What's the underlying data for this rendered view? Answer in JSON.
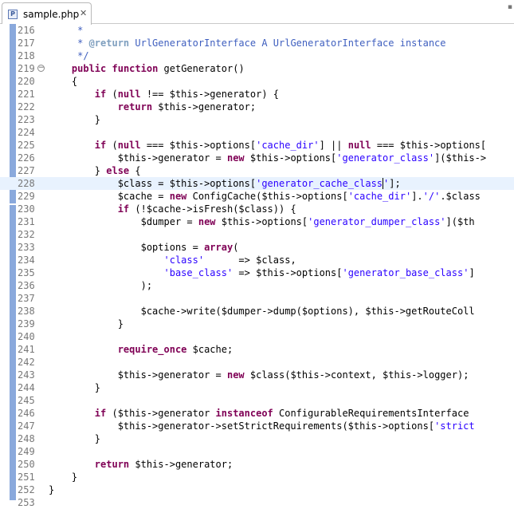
{
  "tab": {
    "filename": "sample.php",
    "icon": "php-file-icon",
    "close_glyph": "✕"
  },
  "corner_glyph": "▪",
  "cursor_line": "228",
  "code_lines": [
    {
      "n": "216",
      "t": [
        [
          "cm",
          "     * "
        ]
      ]
    },
    {
      "n": "217",
      "t": [
        [
          "cm",
          "     * "
        ],
        [
          "tag",
          "@return"
        ],
        [
          "cm",
          " UrlGeneratorInterface A UrlGeneratorInterface instance"
        ]
      ]
    },
    {
      "n": "218",
      "t": [
        [
          "cm",
          "     */"
        ]
      ]
    },
    {
      "n": "219",
      "fold": true,
      "t": [
        [
          "",
          "    "
        ],
        [
          "kw",
          "public"
        ],
        [
          "",
          " "
        ],
        [
          "kw",
          "function"
        ],
        [
          "",
          " getGenerator()"
        ]
      ]
    },
    {
      "n": "220",
      "t": [
        [
          "",
          "    {"
        ]
      ]
    },
    {
      "n": "221",
      "t": [
        [
          "",
          "        "
        ],
        [
          "kw",
          "if"
        ],
        [
          "",
          " ("
        ],
        [
          "kw",
          "null"
        ],
        [
          "",
          " !== $this->generator) {"
        ]
      ]
    },
    {
      "n": "222",
      "t": [
        [
          "",
          "            "
        ],
        [
          "kw",
          "return"
        ],
        [
          "",
          " $this->generator;"
        ]
      ]
    },
    {
      "n": "223",
      "t": [
        [
          "",
          "        }"
        ]
      ]
    },
    {
      "n": "224",
      "t": []
    },
    {
      "n": "225",
      "t": [
        [
          "",
          "        "
        ],
        [
          "kw",
          "if"
        ],
        [
          "",
          " ("
        ],
        [
          "kw",
          "null"
        ],
        [
          "",
          " === $this->options["
        ],
        [
          "str",
          "'cache_dir'"
        ],
        [
          "",
          "] || "
        ],
        [
          "kw",
          "null"
        ],
        [
          "",
          " === $this->options["
        ]
      ]
    },
    {
      "n": "226",
      "t": [
        [
          "",
          "            $this->generator = "
        ],
        [
          "kw",
          "new"
        ],
        [
          "",
          " $this->options["
        ],
        [
          "str",
          "'generator_class'"
        ],
        [
          "",
          "]($this->"
        ]
      ]
    },
    {
      "n": "227",
      "t": [
        [
          "",
          "        } "
        ],
        [
          "kw",
          "else"
        ],
        [
          "",
          " {"
        ]
      ]
    },
    {
      "n": "228",
      "t": [
        [
          "",
          "            $class = $this->options["
        ],
        [
          "str",
          "'generator_cache_class"
        ],
        [
          "caret",
          ""
        ],
        [
          "str",
          "'"
        ],
        [
          "",
          "];"
        ]
      ]
    },
    {
      "n": "229",
      "t": [
        [
          "",
          "            $cache = "
        ],
        [
          "kw",
          "new"
        ],
        [
          "",
          " ConfigCache($this->options["
        ],
        [
          "str",
          "'cache_dir'"
        ],
        [
          "",
          "]."
        ],
        [
          "str",
          "'/'"
        ],
        [
          "",
          ".$class"
        ]
      ]
    },
    {
      "n": "230",
      "t": [
        [
          "",
          "            "
        ],
        [
          "kw",
          "if"
        ],
        [
          "",
          " (!$cache->isFresh($class)) {"
        ]
      ]
    },
    {
      "n": "231",
      "t": [
        [
          "",
          "                $dumper = "
        ],
        [
          "kw",
          "new"
        ],
        [
          "",
          " $this->options["
        ],
        [
          "str",
          "'generator_dumper_class'"
        ],
        [
          "",
          "]($th"
        ]
      ]
    },
    {
      "n": "232",
      "t": []
    },
    {
      "n": "233",
      "t": [
        [
          "",
          "                $options = "
        ],
        [
          "kw",
          "array"
        ],
        [
          "",
          "("
        ]
      ]
    },
    {
      "n": "234",
      "t": [
        [
          "",
          "                    "
        ],
        [
          "str",
          "'class'"
        ],
        [
          "",
          "      => $class,"
        ]
      ]
    },
    {
      "n": "235",
      "t": [
        [
          "",
          "                    "
        ],
        [
          "str",
          "'base_class'"
        ],
        [
          "",
          " => $this->options["
        ],
        [
          "str",
          "'generator_base_class'"
        ],
        [
          "",
          "]"
        ]
      ]
    },
    {
      "n": "236",
      "t": [
        [
          "",
          "                );"
        ]
      ]
    },
    {
      "n": "237",
      "t": []
    },
    {
      "n": "238",
      "t": [
        [
          "",
          "                $cache->write($dumper->dump($options), $this->getRouteColl"
        ]
      ]
    },
    {
      "n": "239",
      "t": [
        [
          "",
          "            }"
        ]
      ]
    },
    {
      "n": "240",
      "t": []
    },
    {
      "n": "241",
      "t": [
        [
          "",
          "            "
        ],
        [
          "kw",
          "require_once"
        ],
        [
          "",
          " $cache;"
        ]
      ]
    },
    {
      "n": "242",
      "t": []
    },
    {
      "n": "243",
      "t": [
        [
          "",
          "            $this->generator = "
        ],
        [
          "kw",
          "new"
        ],
        [
          "",
          " $class($this->context, $this->logger);"
        ]
      ]
    },
    {
      "n": "244",
      "t": [
        [
          "",
          "        }"
        ]
      ]
    },
    {
      "n": "245",
      "t": []
    },
    {
      "n": "246",
      "t": [
        [
          "",
          "        "
        ],
        [
          "kw",
          "if"
        ],
        [
          "",
          " ($this->generator "
        ],
        [
          "kw",
          "instanceof"
        ],
        [
          "",
          " ConfigurableRequirementsInterface"
        ]
      ]
    },
    {
      "n": "247",
      "t": [
        [
          "",
          "            $this->generator->setStrictRequirements($this->options["
        ],
        [
          "str",
          "'strict"
        ]
      ]
    },
    {
      "n": "248",
      "t": [
        [
          "",
          "        }"
        ]
      ]
    },
    {
      "n": "249",
      "t": []
    },
    {
      "n": "250",
      "t": [
        [
          "",
          "        "
        ],
        [
          "kw",
          "return"
        ],
        [
          "",
          " $this->generator;"
        ]
      ]
    },
    {
      "n": "251",
      "t": [
        [
          "",
          "    }"
        ]
      ]
    },
    {
      "n": "252",
      "t": [
        [
          "",
          "}"
        ]
      ]
    },
    {
      "n": "253",
      "t": []
    }
  ]
}
